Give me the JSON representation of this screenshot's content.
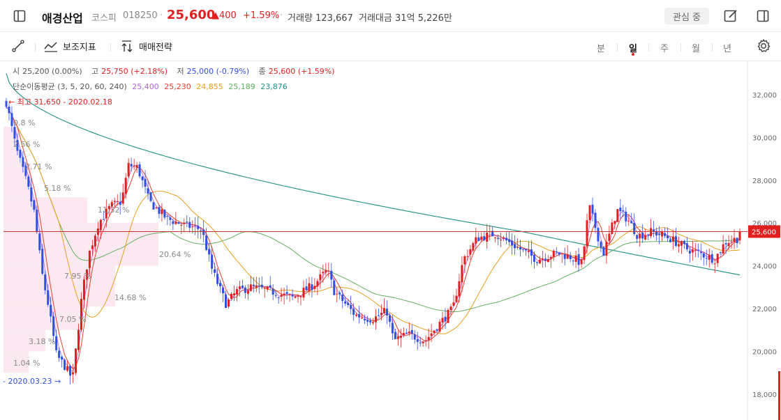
{
  "header": {
    "stock_name": "애경산업",
    "market": "코스피",
    "code": "018250",
    "price": "25,600",
    "change": "▲400",
    "change_pct": "+1.59%",
    "volume_label": "거래량",
    "volume": "123,667",
    "amount_label": "거래대금",
    "amount": "31억 5,226만",
    "watch_label": "관심 중"
  },
  "toolbar": {
    "indicator_label": "보조지표",
    "strategy_label": "매매전략",
    "periods": [
      "분",
      "일",
      "주",
      "월",
      "년"
    ],
    "active_period": "일"
  },
  "info": {
    "open_label": "시",
    "open": "25,200 (0.00%)",
    "high_label": "고",
    "high": "25,750 (+2.18%)",
    "low_label": "저",
    "low": "25,000 (-0.79%)",
    "close_label": "종",
    "close": "25,600 (+1.59%)",
    "ma_label": "단순이동평균 (3, 5, 20, 60, 240)",
    "ma_values": [
      {
        "value": "25,400",
        "color": "#b265e0"
      },
      {
        "value": "25,230",
        "color": "#e04030"
      },
      {
        "value": "24,855",
        "color": "#e8a020"
      },
      {
        "value": "25,189",
        "color": "#60b060"
      },
      {
        "value": "23,876",
        "color": "#209080"
      }
    ]
  },
  "chart_data": {
    "type": "candlestick",
    "y_ticks": [
      "32,000",
      "30,000",
      "28,000",
      "26,000",
      "24,000",
      "22,000",
      "20,000",
      "18,000"
    ],
    "ylim": [
      17300,
      33200
    ],
    "current_price_label": "25,600",
    "current_price": 25600,
    "max_annotation": "← 최고 31,650 - 2020.02.18",
    "min_annotation": "- 2020.03.23 →",
    "volume_profile_labels": [
      "0.8 %",
      "2.56 %",
      "2.71 %",
      "5.18 %",
      "11.32 %",
      "20.64 %",
      "7.95 %",
      "14.68 %",
      "7.05 %",
      "3.18 %",
      "1.04 %"
    ],
    "colors": {
      "up": "#e02020",
      "down": "#3050e0",
      "ma3": "#b265e0",
      "ma5": "#e04030",
      "ma20": "#e8a020",
      "ma60": "#60b060",
      "ma240": "#209080"
    }
  }
}
